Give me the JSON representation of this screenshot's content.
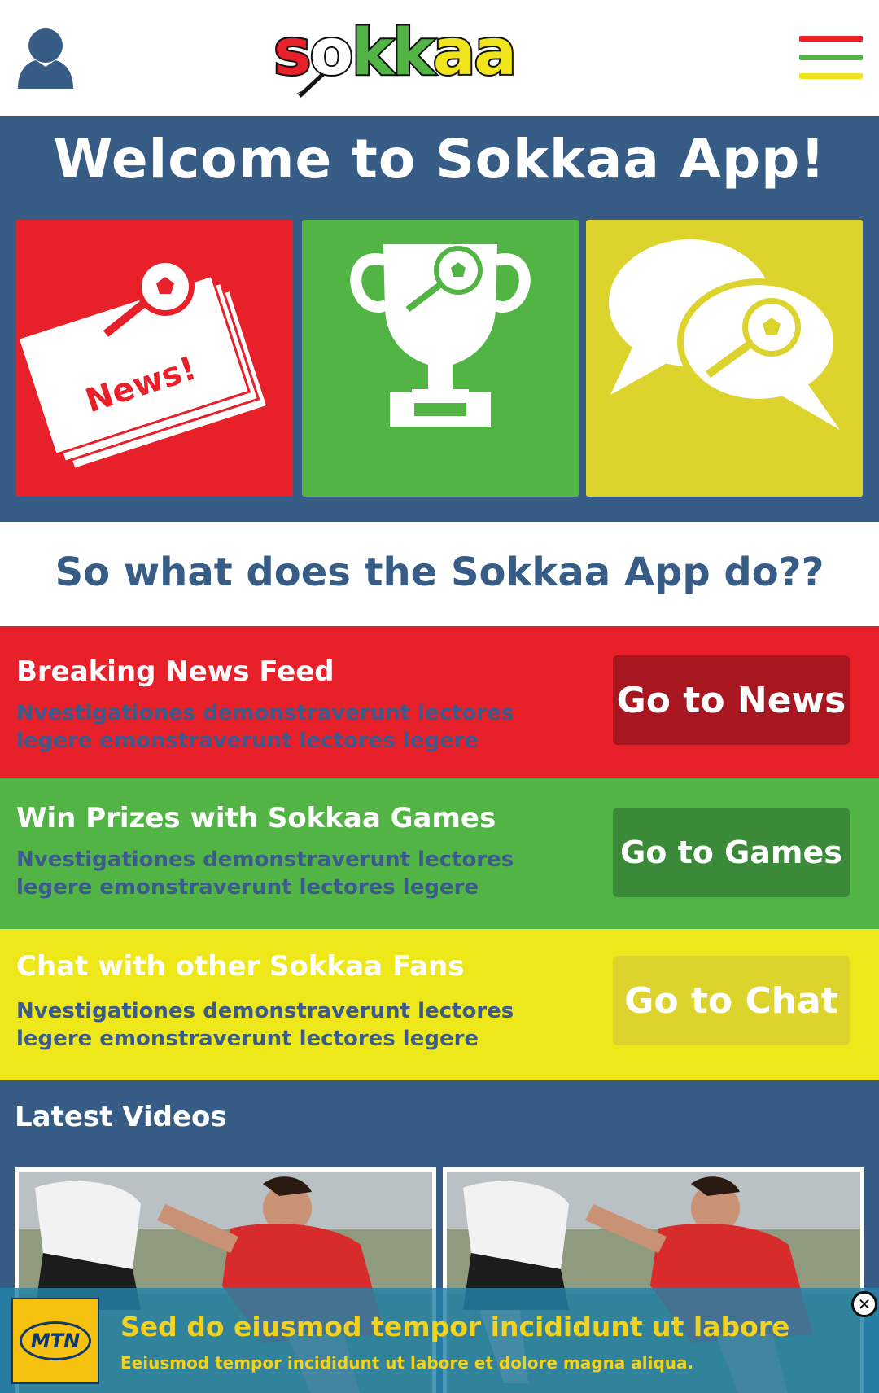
{
  "header": {
    "profile_icon": "user-icon",
    "menu_icon": "hamburger-menu-icon",
    "logo": {
      "text": "sokkaa",
      "letters": [
        "s",
        "o",
        "k",
        "k",
        "a",
        "a"
      ],
      "colors": [
        "#e8202a",
        "#ffffff",
        "#53b446",
        "#53b446",
        "#f0e41c",
        "#f0e41c"
      ]
    },
    "menu_bar_colors": [
      "#e8202a",
      "#53b446",
      "#f0e41c"
    ]
  },
  "welcome": {
    "title": "Welcome to Sokkaa App!",
    "tiles": [
      {
        "name": "news",
        "icon": "newspaper-icon",
        "icon_text": "News!",
        "color": "#e8202a"
      },
      {
        "name": "games",
        "icon": "trophy-icon",
        "color": "#53b446"
      },
      {
        "name": "chat",
        "icon": "chat-bubbles-icon",
        "color": "#dcd32c"
      }
    ]
  },
  "question": {
    "text": "So what does the Sokkaa App do??"
  },
  "features": [
    {
      "title": "Breaking News Feed",
      "description": "Nvestigationes demonstraverunt lectores legere emonstraverunt lectores legere",
      "button": "Go to News",
      "bg": "#e8202a",
      "button_bg": "#a8161f",
      "desc_color": "#3b5b8c"
    },
    {
      "title": "Win Prizes with Sokkaa Games",
      "description": "Nvestigationes demonstraverunt lectores legere emonstraverunt lectores legere",
      "button": "Go to Games",
      "bg": "#53b446",
      "button_bg": "#3a8a3a",
      "desc_color": "#3b5b8c"
    },
    {
      "title": "Chat with other Sokkaa Fans",
      "description": "Nvestigationes demonstraverunt lectores legere emonstraverunt lectores legere",
      "button": "Go to Chat",
      "bg": "#eee81b",
      "button_bg": "#dcd32c",
      "desc_color": "#3b5b8c"
    }
  ],
  "videos": {
    "title": "Latest Videos",
    "items": [
      {
        "thumbnail": "soccer-players-thumbnail"
      },
      {
        "thumbnail": "soccer-players-thumbnail"
      }
    ]
  },
  "ad": {
    "brand": "MTN",
    "headline": "Sed do eiusmod tempor incididunt ut labore",
    "subtext": "Eeiusmod tempor incididunt ut labore et dolore magna aliqua.",
    "close_icon": "close-icon",
    "close_glyph": "✕"
  }
}
